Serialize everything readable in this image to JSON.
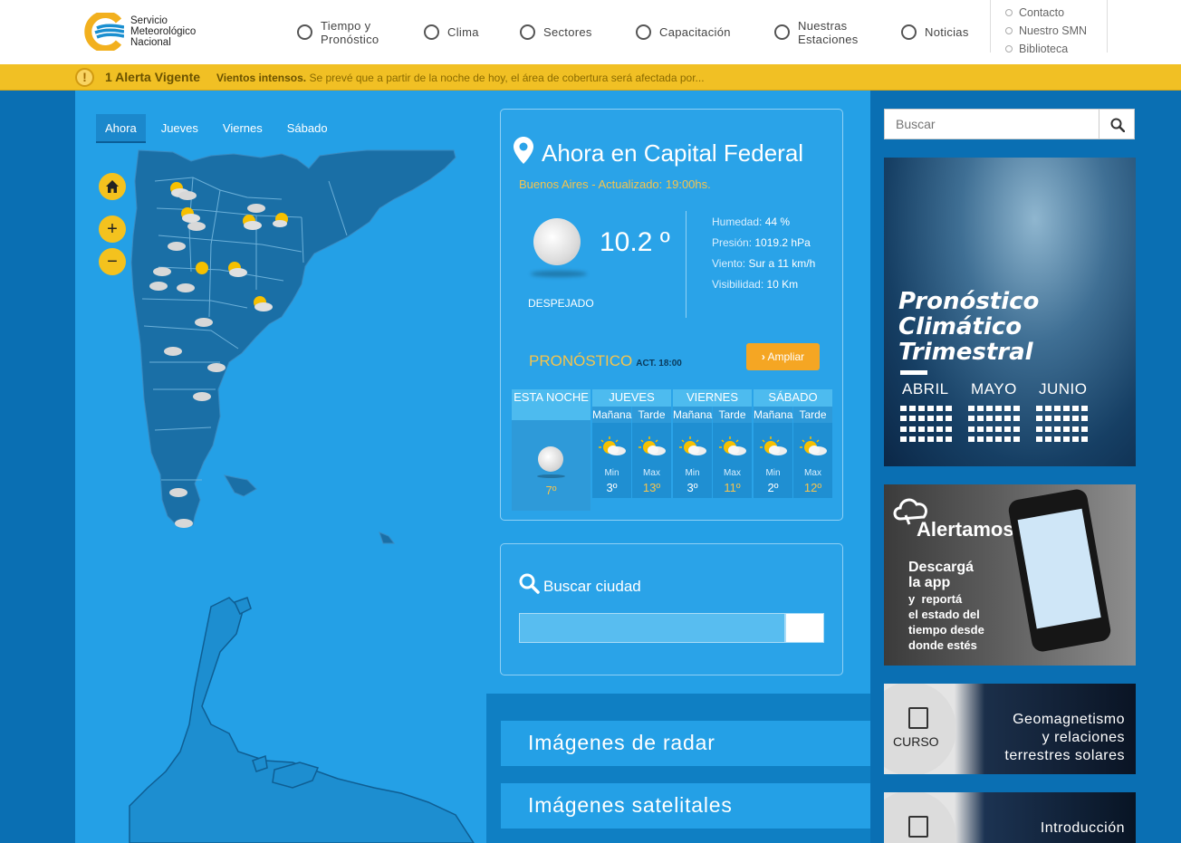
{
  "header": {
    "logo_lines": [
      "Servicio",
      "Meteorológico",
      "Nacional"
    ],
    "nav": [
      {
        "label": "Tiempo y\nPronóstico"
      },
      {
        "label": "Clima"
      },
      {
        "label": "Sectores"
      },
      {
        "label": "Capacitación"
      },
      {
        "label": "Nuestras\nEstaciones"
      },
      {
        "label": "Noticias"
      }
    ],
    "top_links": [
      "Contacto",
      "Nuestro SMN",
      "Biblioteca"
    ]
  },
  "alert": {
    "count": "1 Alerta Vigente",
    "type": "Vientos intensos.",
    "text": " Se prevé que a partir de la noche de hoy, el área de cobertura será afectada por..."
  },
  "map": {
    "tabs": [
      "Ahora",
      "Jueves",
      "Viernes",
      "Sábado"
    ],
    "active_tab": "Ahora",
    "controls": {
      "home": "home-icon",
      "zoom_in": "+",
      "zoom_out": "−"
    }
  },
  "now": {
    "title": "Ahora en Capital Federal",
    "subtitle": "Buenos Aires - Actualizado: 19:00hs.",
    "temperature": "10.2 º",
    "condition": "DESPEJADO",
    "stats": {
      "humidity_label": "Humedad:",
      "humidity": "44 %",
      "pressure_label": "Presión:",
      "pressure": "1019.2 hPa",
      "wind_label": "Viento:",
      "wind": "Sur a 11 km/h",
      "visibility_label": "Visibilidad:",
      "visibility": "10 Km"
    },
    "forecast_title": "PRONÓSTICO",
    "forecast_act": "ACT. 18:00",
    "ampliar": "Ampliar"
  },
  "forecast": {
    "tonight": {
      "label": "ESTA NOCHE",
      "temp": "7º"
    },
    "days": [
      {
        "name": "JUEVES",
        "am": "Mañana",
        "pm": "Tarde",
        "min_label": "Min",
        "max_label": "Max",
        "min": "3º",
        "max": "13º"
      },
      {
        "name": "VIERNES",
        "am": "Mañana",
        "pm": "Tarde",
        "min_label": "Min",
        "max_label": "Max",
        "min": "3º",
        "max": "11º"
      },
      {
        "name": "SÁBADO",
        "am": "Mañana",
        "pm": "Tarde",
        "min_label": "Min",
        "max_label": "Max",
        "min": "2º",
        "max": "12º"
      }
    ]
  },
  "city_search": {
    "title": "Buscar ciudad",
    "value": ""
  },
  "links": {
    "radar": "Imágenes de radar",
    "satellite": "Imágenes satelitales"
  },
  "search": {
    "placeholder": "Buscar"
  },
  "banners": {
    "climate": {
      "lines": [
        "Pronóstico",
        "Climático",
        "Trimestral"
      ],
      "months": [
        "ABRIL",
        "MAYO",
        "JUNIO"
      ]
    },
    "app": {
      "brand": "Alertamos",
      "heading": [
        "Descargá",
        "la app"
      ],
      "text": [
        "y  reportá",
        "el estado del",
        "tiempo desde",
        "donde estés"
      ]
    },
    "course1": {
      "label": "CURSO",
      "lines": [
        "Geomagnetismo",
        "y relaciones",
        "terrestres solares"
      ]
    },
    "course2": {
      "lines": [
        "Introducción"
      ]
    }
  },
  "colors": {
    "accent": "#f5a623",
    "alert": "#f1c024",
    "primary": "#24a0e6",
    "dark_blue": "#0a6fb3"
  }
}
